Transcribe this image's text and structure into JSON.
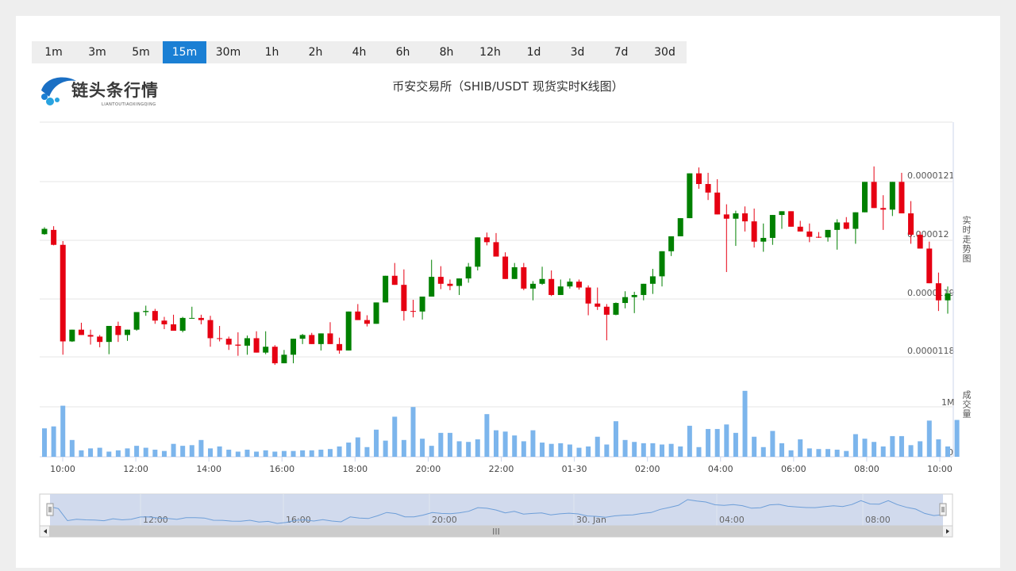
{
  "tabs": [
    {
      "label": "1m",
      "active": false
    },
    {
      "label": "3m",
      "active": false
    },
    {
      "label": "5m",
      "active": false
    },
    {
      "label": "15m",
      "active": true
    },
    {
      "label": "30m",
      "active": false
    },
    {
      "label": "1h",
      "active": false
    },
    {
      "label": "2h",
      "active": false
    },
    {
      "label": "4h",
      "active": false
    },
    {
      "label": "6h",
      "active": false
    },
    {
      "label": "8h",
      "active": false
    },
    {
      "label": "12h",
      "active": false
    },
    {
      "label": "1d",
      "active": false
    },
    {
      "label": "3d",
      "active": false
    },
    {
      "label": "7d",
      "active": false
    },
    {
      "label": "30d",
      "active": false
    }
  ],
  "logo": {
    "text": "链头条行情",
    "subtext": "LIANTOUTIAOXINGQING"
  },
  "colors": {
    "up": "#008000",
    "down": "#e60012",
    "volume": "#7cb5ec",
    "accent": "#1a7fd4",
    "navigator_fill": "#ccd6eb"
  },
  "chart_data": {
    "type": "candlestick",
    "title": "币安交易所（SHIB/USDT 现货实时K线图）",
    "price_axis_label": "实时走势图",
    "volume_axis_label": "成交量",
    "price_ticks": [
      "0.0000121",
      "0.000012",
      "0.0000119",
      "0.0000118"
    ],
    "volume_ticks": [
      "1M",
      "0"
    ],
    "ylim": [
      1.178e-05,
      1.222e-05
    ],
    "x_ticks": [
      "10:00",
      "12:00",
      "14:00",
      "16:00",
      "18:00",
      "20:00",
      "22:00",
      "01-30",
      "02:00",
      "04:00",
      "06:00",
      "08:00",
      "10:00"
    ],
    "navigator_ticks": [
      "12:00",
      "16:00",
      "20:00",
      "30. Jan",
      "04:00",
      "08:00"
    ],
    "scroll_handle": "III",
    "candles": [
      [
        1201.0,
        1202.3,
        1200.9,
        1202.0
      ],
      [
        1201.8,
        1202.5,
        1198.9,
        1199.0
      ],
      [
        1199.0,
        1199.7,
        1178.4,
        1180.9
      ],
      [
        1180.9,
        1182.8,
        1180.8,
        1183.1
      ],
      [
        1183.1,
        1184.4,
        1182.3,
        1182.1
      ],
      [
        1182.1,
        1183.1,
        1180.3,
        1181.8
      ],
      [
        1181.8,
        1182.1,
        1179.8,
        1180.8
      ],
      [
        1180.8,
        1181.1,
        1178.5,
        1183.8
      ],
      [
        1183.8,
        1184.6,
        1180.8,
        1182.1
      ],
      [
        1182.1,
        1182.9,
        1181.0,
        1183.1
      ],
      [
        1183.1,
        1186.3,
        1182.9,
        1186.4
      ],
      [
        1186.4,
        1187.6,
        1185.7,
        1186.6
      ],
      [
        1186.6,
        1187.0,
        1184.2,
        1184.8
      ],
      [
        1184.8,
        1185.5,
        1183.2,
        1184.1
      ],
      [
        1184.1,
        1185.9,
        1182.9,
        1182.9
      ],
      [
        1182.9,
        1185.5,
        1182.6,
        1185.3
      ],
      [
        1185.3,
        1187.4,
        1185.4,
        1185.3
      ],
      [
        1185.3,
        1185.9,
        1184.1,
        1184.9
      ],
      [
        1184.9,
        1185.7,
        1179.9,
        1181.5
      ],
      [
        1181.5,
        1183.8,
        1180.9,
        1181.4
      ],
      [
        1181.4,
        1181.8,
        1179.3,
        1180.3
      ],
      [
        1180.3,
        1182.6,
        1178.2,
        1180.1
      ],
      [
        1180.1,
        1182.0,
        1178.4,
        1181.5
      ],
      [
        1181.5,
        1182.8,
        1179.9,
        1178.8
      ],
      [
        1178.8,
        1182.8,
        1178.5,
        1179.9
      ],
      [
        1179.9,
        1180.2,
        1176.5,
        1176.8
      ],
      [
        1176.8,
        1179.3,
        1178.6,
        1178.4
      ],
      [
        1178.4,
        1178.9,
        1176.8,
        1181.4
      ],
      [
        1181.4,
        1182.3,
        1180.4,
        1182.1
      ],
      [
        1182.1,
        1182.5,
        1181.2,
        1180.4
      ],
      [
        1180.4,
        1181.3,
        1179.2,
        1182.4
      ],
      [
        1182.4,
        1184.5,
        1180.9,
        1180.4
      ],
      [
        1180.4,
        1181.6,
        1178.6,
        1179.2
      ],
      [
        1179.2,
        1184.5,
        1180.1,
        1186.5
      ],
      [
        1186.5,
        1187.9,
        1185.1,
        1184.9
      ],
      [
        1184.9,
        1185.8,
        1183.7,
        1184.2
      ],
      [
        1184.2,
        1187.4,
        1184.8,
        1188.2
      ],
      [
        1188.2,
        1192.6,
        1189.7,
        1193.2
      ],
      [
        1193.2,
        1195.6,
        1191.5,
        1191.5
      ],
      [
        1191.5,
        1194.4,
        1184.8,
        1186.6
      ],
      [
        1186.6,
        1188.7,
        1185.4,
        1186.5
      ],
      [
        1186.5,
        1186.9,
        1185.0,
        1189.3
      ],
      [
        1189.3,
        1196.2,
        1190.6,
        1193.0
      ],
      [
        1193.0,
        1195.0,
        1190.7,
        1191.7
      ],
      [
        1191.7,
        1192.5,
        1190.5,
        1191.3
      ],
      [
        1191.3,
        1192.1,
        1189.6,
        1192.7
      ],
      [
        1192.7,
        1195.6,
        1191.9,
        1194.9
      ],
      [
        1194.9,
        1200.0,
        1194.2,
        1200.4
      ],
      [
        1200.4,
        1201.3,
        1198.9,
        1199.5
      ],
      [
        1199.5,
        1201.2,
        1196.8,
        1196.8
      ],
      [
        1196.8,
        1197.6,
        1192.8,
        1192.6
      ],
      [
        1192.6,
        1195.6,
        1192.8,
        1194.8
      ],
      [
        1194.8,
        1195.6,
        1190.5,
        1190.8
      ],
      [
        1190.8,
        1192.2,
        1188.6,
        1191.7
      ],
      [
        1191.7,
        1194.9,
        1191.5,
        1192.6
      ],
      [
        1192.6,
        1194.2,
        1189.4,
        1189.6
      ],
      [
        1189.6,
        1192.5,
        1189.8,
        1191.2
      ],
      [
        1191.2,
        1192.7,
        1190.8,
        1192.1
      ],
      [
        1192.1,
        1192.5,
        1190.6,
        1191.0
      ],
      [
        1191.0,
        1191.4,
        1185.8,
        1188.0
      ],
      [
        1188.0,
        1191.0,
        1186.8,
        1187.4
      ],
      [
        1187.4,
        1187.9,
        1181.1,
        1185.9
      ],
      [
        1185.9,
        1188.2,
        1185.8,
        1188.1
      ],
      [
        1188.1,
        1190.3,
        1187.1,
        1189.2
      ],
      [
        1189.2,
        1190.2,
        1186.2,
        1189.6
      ],
      [
        1189.6,
        1190.5,
        1188.6,
        1191.7
      ],
      [
        1191.7,
        1194.5,
        1189.8,
        1193.1
      ],
      [
        1193.1,
        1196.3,
        1191.2,
        1197.8
      ],
      [
        1197.8,
        1200.2,
        1196.9,
        1200.6
      ],
      [
        1200.6,
        1203.0,
        1201.5,
        1204.0
      ],
      [
        1204.0,
        1211.5,
        1208.4,
        1212.4
      ],
      [
        1212.4,
        1213.5,
        1209.5,
        1210.4
      ],
      [
        1210.4,
        1212.5,
        1207.4,
        1208.8
      ],
      [
        1208.8,
        1211.3,
        1207.8,
        1204.7
      ],
      [
        1204.7,
        1206.6,
        1193.9,
        1203.9
      ],
      [
        1203.9,
        1205.4,
        1198.8,
        1204.9
      ],
      [
        1204.9,
        1206.2,
        1201.5,
        1203.4
      ],
      [
        1203.4,
        1205.8,
        1198.5,
        1199.6
      ],
      [
        1199.6,
        1203.0,
        1197.7,
        1200.3
      ],
      [
        1200.3,
        1203.5,
        1199.0,
        1204.6
      ],
      [
        1204.6,
        1205.2,
        1202.0,
        1205.3
      ],
      [
        1205.3,
        1205.2,
        1202.5,
        1202.4
      ],
      [
        1202.4,
        1203.5,
        1203.8,
        1201.5
      ],
      [
        1201.5,
        1203.0,
        1199.5,
        1200.5
      ],
      [
        1200.5,
        1201.4,
        1200.3,
        1200.4
      ],
      [
        1200.4,
        1201.2,
        1199.6,
        1201.8
      ],
      [
        1201.8,
        1203.8,
        1198.1,
        1203.2
      ],
      [
        1203.2,
        1204.2,
        1201.9,
        1202.0
      ],
      [
        1202.0,
        1203.3,
        1199.2,
        1205.1
      ],
      [
        1205.1,
        1210.2,
        1205.1,
        1210.8
      ],
      [
        1210.8,
        1213.7,
        1207.6,
        1205.9
      ],
      [
        1205.9,
        1208.3,
        1201.8,
        1205.6
      ],
      [
        1205.6,
        1210.0,
        1204.4,
        1210.8
      ],
      [
        1210.8,
        1212.5,
        1206.6,
        1204.9
      ],
      [
        1204.9,
        1207.2,
        1199.2,
        1200.9
      ],
      [
        1200.9,
        1201.5,
        1199.0,
        1198.3
      ],
      [
        1198.3,
        1199.6,
        1195.7,
        1191.8
      ],
      [
        1191.8,
        1193.8,
        1186.6,
        1188.6
      ],
      [
        1188.6,
        1191.2,
        1186.1,
        1189.9
      ]
    ],
    "volume": [
      0.44,
      0.47,
      0.79,
      0.26,
      0.1,
      0.13,
      0.14,
      0.08,
      0.1,
      0.13,
      0.17,
      0.14,
      0.11,
      0.09,
      0.2,
      0.17,
      0.18,
      0.26,
      0.13,
      0.16,
      0.11,
      0.08,
      0.11,
      0.08,
      0.1,
      0.08,
      0.09,
      0.09,
      0.1,
      0.1,
      0.11,
      0.12,
      0.16,
      0.22,
      0.3,
      0.15,
      0.42,
      0.25,
      0.62,
      0.26,
      0.77,
      0.28,
      0.17,
      0.37,
      0.37,
      0.24,
      0.23,
      0.27,
      0.66,
      0.41,
      0.39,
      0.33,
      0.24,
      0.41,
      0.22,
      0.2,
      0.21,
      0.19,
      0.14,
      0.16,
      0.31,
      0.19,
      0.55,
      0.26,
      0.23,
      0.21,
      0.21,
      0.19,
      0.2,
      0.16,
      0.48,
      0.15,
      0.43,
      0.43,
      0.5,
      0.37,
      1.02,
      0.31,
      0.15,
      0.4,
      0.21,
      0.1,
      0.27,
      0.13,
      0.12,
      0.12,
      0.11,
      0.09,
      0.35,
      0.28,
      0.23,
      0.16,
      0.32,
      0.32,
      0.18,
      0.24,
      0.56,
      0.27,
      0.16,
      0.57
    ]
  }
}
